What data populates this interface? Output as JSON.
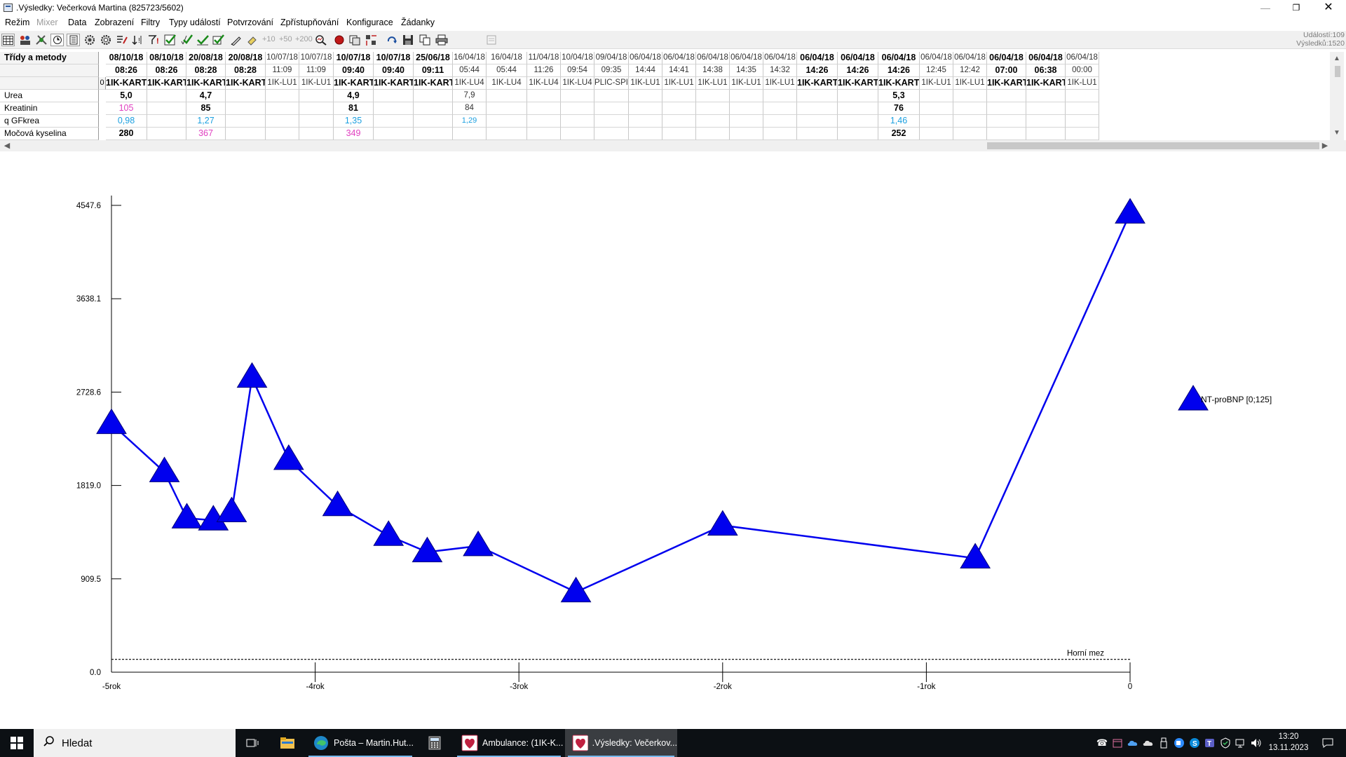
{
  "window": {
    "title": ".Výsledky: Večerková Martina (825723/5602)",
    "controls": {
      "minimize": "—",
      "restore": "❐",
      "close": "✕"
    }
  },
  "menu": [
    "Režim",
    "Mixer",
    "Data",
    "Zobrazení",
    "Filtry",
    "Typy událostí",
    "Potvrzování",
    "Zpřístupňování",
    "Konfigurace",
    "Žádanky"
  ],
  "menu_disabled": [
    "Mixer"
  ],
  "toolbar": {
    "disabled_labels": [
      "+10",
      "+50",
      "+200"
    ],
    "counts": {
      "events": "Událostí:109",
      "results": "Výsledků:1520"
    }
  },
  "table": {
    "corner_label": "Třídy a metody",
    "marker": "0",
    "columns": [
      {
        "date": "08/10/18",
        "time": "08:26",
        "dept": "1IK-KART",
        "bold": true
      },
      {
        "date": "08/10/18",
        "time": "08:26",
        "dept": "1IK-KART",
        "bold": true
      },
      {
        "date": "20/08/18",
        "time": "08:28",
        "dept": "1IK-KART",
        "bold": true
      },
      {
        "date": "20/08/18",
        "time": "08:28",
        "dept": "1IK-KART",
        "bold": true
      },
      {
        "date": "10/07/18",
        "time": "11:09",
        "dept": "1IK-LU1",
        "bold": false
      },
      {
        "date": "10/07/18",
        "time": "11:09",
        "dept": "1IK-LU1",
        "bold": false
      },
      {
        "date": "10/07/18",
        "time": "09:40",
        "dept": "1IK-KART",
        "bold": true
      },
      {
        "date": "10/07/18",
        "time": "09:40",
        "dept": "1IK-KART",
        "bold": true
      },
      {
        "date": "25/06/18",
        "time": "09:11",
        "dept": "1IK-KART",
        "bold": true
      },
      {
        "date": "16/04/18",
        "time": "05:44",
        "dept": "1IK-LU4",
        "bold": false
      },
      {
        "date": "16/04/18",
        "time": "05:44",
        "dept": "1IK-LU4",
        "bold": false
      },
      {
        "date": "11/04/18",
        "time": "11:26",
        "dept": "1IK-LU4",
        "bold": false
      },
      {
        "date": "10/04/18",
        "time": "09:54",
        "dept": "1IK-LU4",
        "bold": false
      },
      {
        "date": "09/04/18",
        "time": "09:35",
        "dept": "PLIC-SPI",
        "bold": false
      },
      {
        "date": "06/04/18",
        "time": "14:44",
        "dept": "1IK-LU1",
        "bold": false
      },
      {
        "date": "06/04/18",
        "time": "14:41",
        "dept": "1IK-LU1",
        "bold": false
      },
      {
        "date": "06/04/18",
        "time": "14:38",
        "dept": "1IK-LU1",
        "bold": false
      },
      {
        "date": "06/04/18",
        "time": "14:35",
        "dept": "1IK-LU1",
        "bold": false
      },
      {
        "date": "06/04/18",
        "time": "14:32",
        "dept": "1IK-LU1",
        "bold": false
      },
      {
        "date": "06/04/18",
        "time": "14:26",
        "dept": "1IK-KART",
        "bold": true
      },
      {
        "date": "06/04/18",
        "time": "14:26",
        "dept": "1IK-KART",
        "bold": true
      },
      {
        "date": "06/04/18",
        "time": "14:26",
        "dept": "1IK-KART",
        "bold": true
      },
      {
        "date": "06/04/18",
        "time": "12:45",
        "dept": "1IK-LU1",
        "bold": false
      },
      {
        "date": "06/04/18",
        "time": "12:42",
        "dept": "1IK-LU1",
        "bold": false
      },
      {
        "date": "06/04/18",
        "time": "07:00",
        "dept": "1IK-KART",
        "bold": true
      },
      {
        "date": "06/04/18",
        "time": "06:38",
        "dept": "1IK-KART",
        "bold": true
      },
      {
        "date": "06/04/18",
        "time": "00:00",
        "dept": "1IK-LU1",
        "bold": false
      }
    ],
    "rows": [
      {
        "label": "Urea",
        "cells": [
          {
            "col": 0,
            "v": "5,0",
            "style": "bold"
          },
          {
            "col": 2,
            "v": "4,7",
            "style": "bold"
          },
          {
            "col": 6,
            "v": "4,9",
            "style": "bold"
          },
          {
            "col": 9,
            "v": "7,9",
            "style": "thin"
          },
          {
            "col": 21,
            "v": "5,3",
            "style": "bold"
          }
        ]
      },
      {
        "label": "Kreatinin",
        "cells": [
          {
            "col": 0,
            "v": "105",
            "style": "magenta"
          },
          {
            "col": 2,
            "v": "85",
            "style": "bold"
          },
          {
            "col": 6,
            "v": "81",
            "style": "bold"
          },
          {
            "col": 9,
            "v": "84",
            "style": "thin"
          },
          {
            "col": 21,
            "v": "76",
            "style": "bold"
          }
        ]
      },
      {
        "label": "q GFkrea",
        "cells": [
          {
            "col": 0,
            "v": "0,98",
            "style": "cyan"
          },
          {
            "col": 2,
            "v": "1,27",
            "style": "cyan"
          },
          {
            "col": 6,
            "v": "1,35",
            "style": "cyan"
          },
          {
            "col": 9,
            "v": "1,29",
            "style": "cyan-thin"
          },
          {
            "col": 21,
            "v": "1,46",
            "style": "cyan"
          }
        ]
      },
      {
        "label": "Močová kyselina",
        "cells": [
          {
            "col": 0,
            "v": "280",
            "style": "bold"
          },
          {
            "col": 2,
            "v": "367",
            "style": "magenta"
          },
          {
            "col": 6,
            "v": "349",
            "style": "magenta"
          },
          {
            "col": 21,
            "v": "252",
            "style": "bold"
          }
        ]
      }
    ],
    "colors": {
      "magenta": "#e040c0",
      "cyan": "#1ca0e0"
    }
  },
  "chart_data": {
    "type": "line",
    "title": "",
    "xlabel": "",
    "ylabel": "",
    "x_ticks": [
      "-5rok",
      "-4rok",
      "-3rok",
      "-2rok",
      "-1rok",
      "0"
    ],
    "x_tick_values": [
      -5,
      -4,
      -3,
      -2,
      -1,
      0
    ],
    "xlim": [
      -5,
      0
    ],
    "y_ticks": [
      "0.0",
      "909.5",
      "1819.0",
      "2728.6",
      "3638.1",
      "4547.6"
    ],
    "ylim": [
      0,
      4547.6
    ],
    "series": [
      {
        "name": "NT-proBNP [0;125]",
        "color": "#0000ee",
        "marker": "triangle",
        "points": [
          {
            "x": -5.0,
            "y": 2420
          },
          {
            "x": -4.74,
            "y": 1950
          },
          {
            "x": -4.63,
            "y": 1500
          },
          {
            "x": -4.5,
            "y": 1480
          },
          {
            "x": -4.41,
            "y": 1560
          },
          {
            "x": -4.31,
            "y": 2870
          },
          {
            "x": -4.13,
            "y": 2070
          },
          {
            "x": -3.89,
            "y": 1620
          },
          {
            "x": -3.64,
            "y": 1330
          },
          {
            "x": -3.45,
            "y": 1170
          },
          {
            "x": -3.2,
            "y": 1230
          },
          {
            "x": -2.72,
            "y": 780
          },
          {
            "x": -2.0,
            "y": 1430
          },
          {
            "x": -0.76,
            "y": 1110
          },
          {
            "x": 0.0,
            "y": 4470
          }
        ]
      }
    ],
    "reference_line": {
      "label": "Horní mez",
      "y": 125,
      "style": "dotted"
    },
    "legend": {
      "position": "right",
      "entries": [
        "NT-proBNP [0;125]"
      ]
    },
    "grid": false
  },
  "taskbar": {
    "search_placeholder": "Hledat",
    "apps": [
      {
        "label": "Pošta – Martin.Hut...",
        "active": false
      },
      {
        "label": "Ambulance: (1IK-K...",
        "active": false
      },
      {
        "label": ".Výsledky: Večerkov...",
        "active": true
      }
    ],
    "clock": {
      "time": "13:20",
      "date": "13.11.2023"
    }
  }
}
